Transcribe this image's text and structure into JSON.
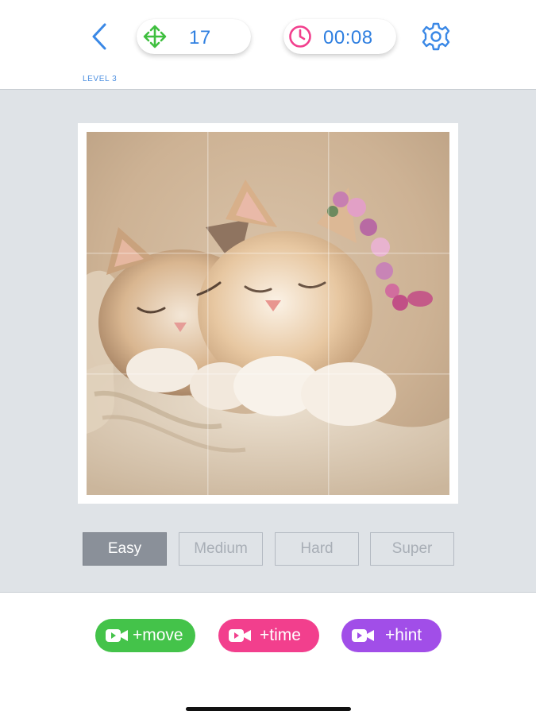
{
  "header": {
    "moves": "17",
    "timer": "00:08",
    "level": "LEVEL 3"
  },
  "icons": {
    "back": "chevron-left-icon",
    "moves": "move-arrows-icon",
    "timer": "clock-icon",
    "settings": "gear-icon",
    "video": "video-camera-icon"
  },
  "colors": {
    "accent_blue": "#2f7fe0",
    "move_green": "#44c34a",
    "time_pink": "#f23f8d",
    "hint_purple": "#a14ee8",
    "board_bg": "#dfe3e7"
  },
  "puzzle": {
    "grid": "3x3",
    "image": "two sleeping kittens with flower crown"
  },
  "difficulty": {
    "options": [
      "Easy",
      "Medium",
      "Hard",
      "Super"
    ],
    "selected": "Easy"
  },
  "bonuses": {
    "move": "+move",
    "time": "+time",
    "hint": "+hint"
  }
}
